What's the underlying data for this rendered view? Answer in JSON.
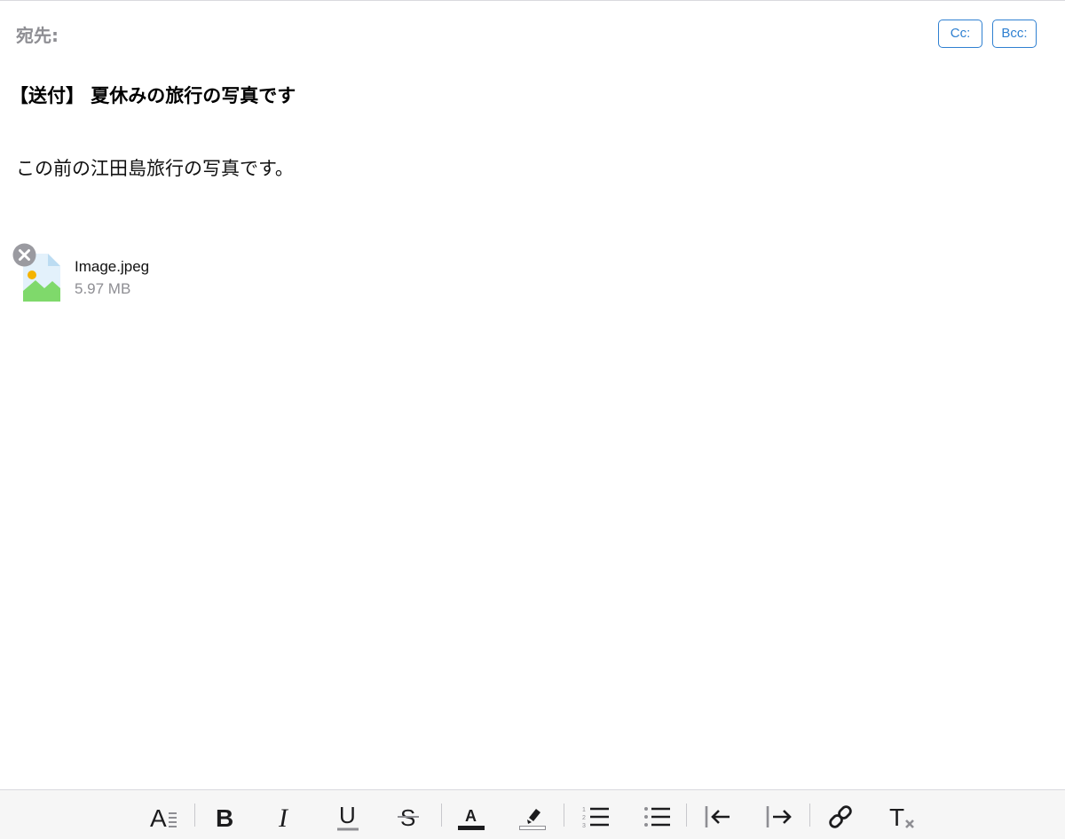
{
  "header": {
    "to_label": "宛先:",
    "cc_label": "Cc:",
    "bcc_label": "Bcc:"
  },
  "subject": "【送付】 夏休みの旅行の写真です",
  "body": "この前の江田島旅行の写真です。",
  "attachment": {
    "name": "Image.jpeg",
    "size": "5.97 MB"
  },
  "colors": {
    "accent": "#2f80d1",
    "muted": "#8e8e93"
  },
  "toolbar": {
    "icons": [
      "text-style-icon",
      "bold-icon",
      "italic-icon",
      "underline-icon",
      "strikethrough-icon",
      "text-color-icon",
      "highlight-icon",
      "numbered-list-icon",
      "bullet-list-icon",
      "outdent-icon",
      "indent-icon",
      "link-icon",
      "clear-format-icon"
    ]
  }
}
